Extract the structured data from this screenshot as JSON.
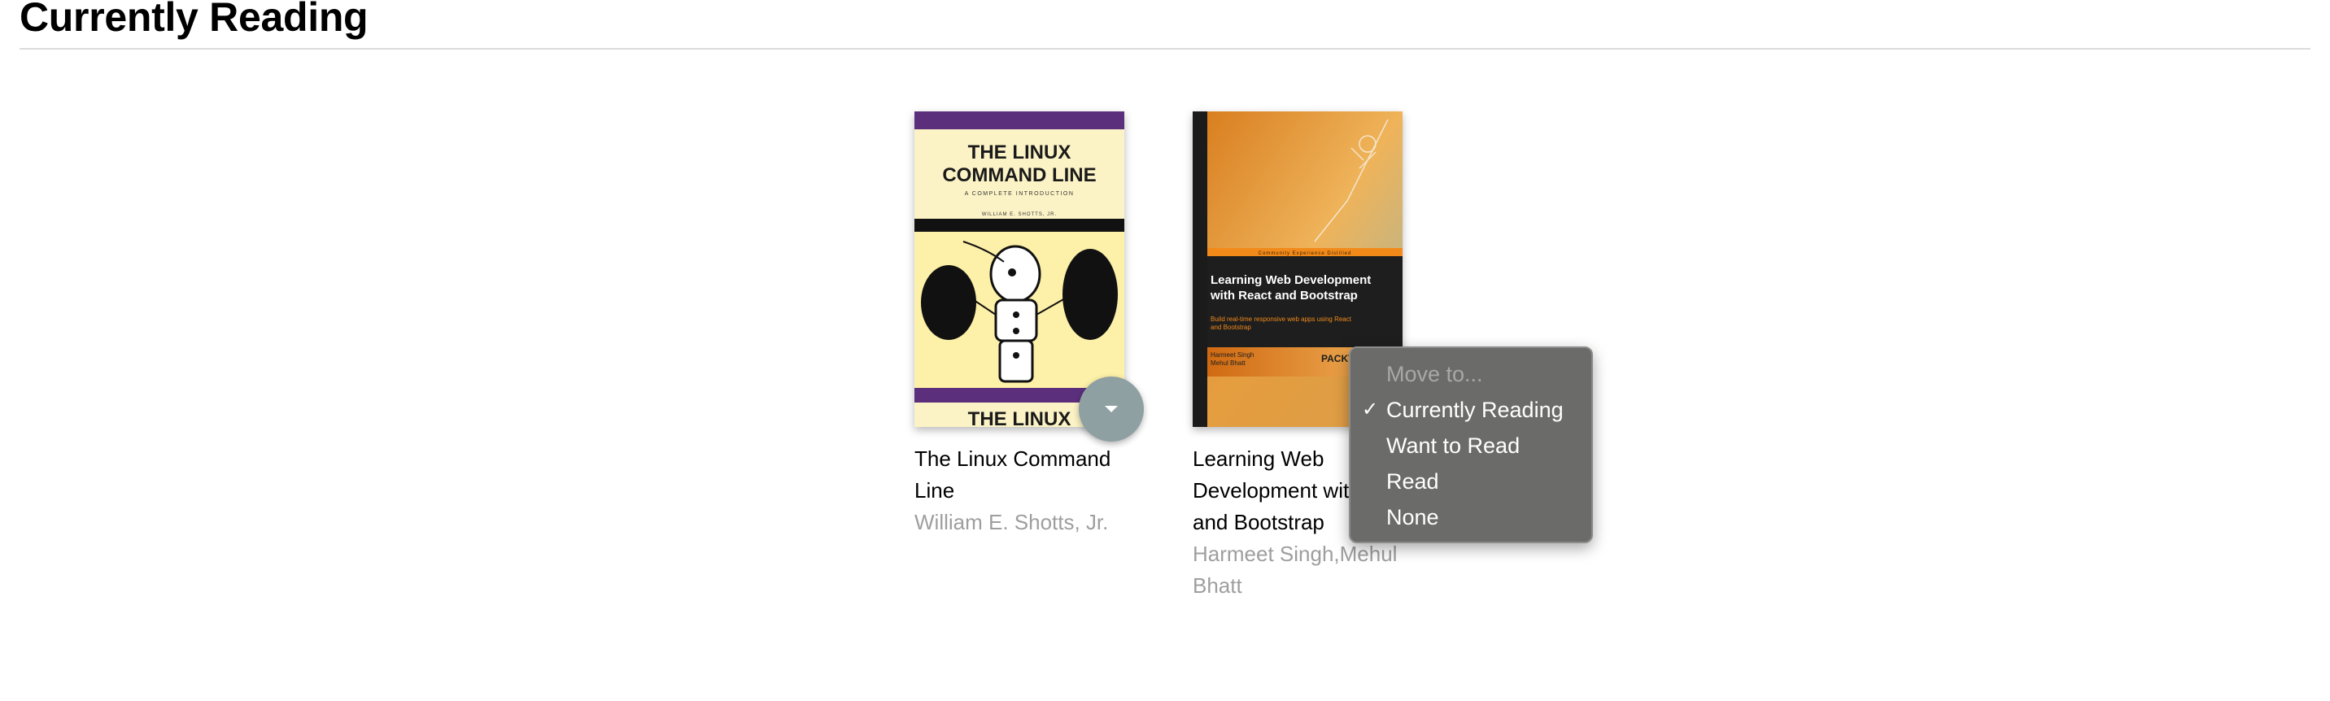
{
  "shelf": {
    "title": "Currently Reading"
  },
  "books": [
    {
      "title": "The Linux Command Line",
      "authors": "William E. Shotts, Jr.",
      "cover": {
        "title_line1": "THE LINUX",
        "title_line2": "COMMAND LINE",
        "subtitle": "A COMPLETE INTRODUCTION",
        "author": "WILLIAM E. SHOTTS, JR.",
        "bottom_text": "THE LINUX"
      }
    },
    {
      "title_line1": "Learning Web",
      "title_line2": "Development wit",
      "title_line3": "and Bootstrap",
      "authors_line1": "Harmeet Singh,Mehul",
      "authors_line2": "Bhatt",
      "cover": {
        "banner": "Community Experience Distilled",
        "title_line1": "Learning Web Development",
        "title_line2": "with React and Bootstrap",
        "tagline_line1": "Build real-time responsive web apps using React",
        "tagline_line2": "and Bootstrap",
        "author_line1": "Harmeet Singh",
        "author_line2": "Mehul Bhatt",
        "publisher": "PACKT"
      }
    }
  ],
  "shelf_menu": {
    "header": "Move to...",
    "options": [
      {
        "label": "Currently Reading",
        "checked": true
      },
      {
        "label": "Want to Read",
        "checked": false
      },
      {
        "label": "Read",
        "checked": false
      },
      {
        "label": "None",
        "checked": false
      }
    ],
    "check_glyph": "✓"
  },
  "colors": {
    "changer_button": "#8fa0a2",
    "menu_background": "#6b6c6a",
    "author_text": "#9e9e9e"
  },
  "icons": {
    "shelf_changer": "triangle-down-icon"
  }
}
